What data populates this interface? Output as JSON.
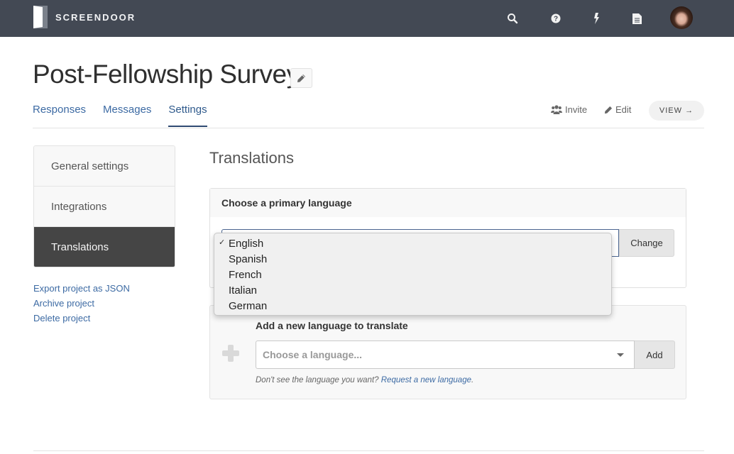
{
  "topbar": {
    "brand": "SCREENDOOR",
    "icons": [
      "search-icon",
      "help-icon",
      "bolt-icon",
      "document-icon"
    ],
    "avatar": "user-avatar"
  },
  "header": {
    "title": "Post-Fellowship Survey",
    "tabs": [
      {
        "label": "Responses",
        "active": false
      },
      {
        "label": "Messages",
        "active": false
      },
      {
        "label": "Settings",
        "active": true
      }
    ],
    "actions": {
      "invite": "Invite",
      "edit": "Edit",
      "view": "VIEW →"
    }
  },
  "sidebar": {
    "items": [
      {
        "label": "General settings",
        "active": false
      },
      {
        "label": "Integrations",
        "active": false
      },
      {
        "label": "Translations",
        "active": true
      }
    ],
    "links": [
      "Export project as JSON",
      "Archive project",
      "Delete project"
    ]
  },
  "main": {
    "title": "Translations",
    "primary": {
      "heading": "Choose a primary language",
      "selected": "English",
      "options": [
        "English",
        "Spanish",
        "French",
        "Italian",
        "German"
      ],
      "change_label": "Change"
    },
    "add": {
      "heading": "Add a new language to translate",
      "placeholder": "Choose a language...",
      "add_label": "Add",
      "help_prefix": "Don't see the language you want? ",
      "help_link": "Request a new language",
      "help_suffix": "."
    }
  },
  "colors": {
    "topbar": "#434954",
    "link": "#3c6aa3",
    "active_sidebar": "#454545"
  }
}
